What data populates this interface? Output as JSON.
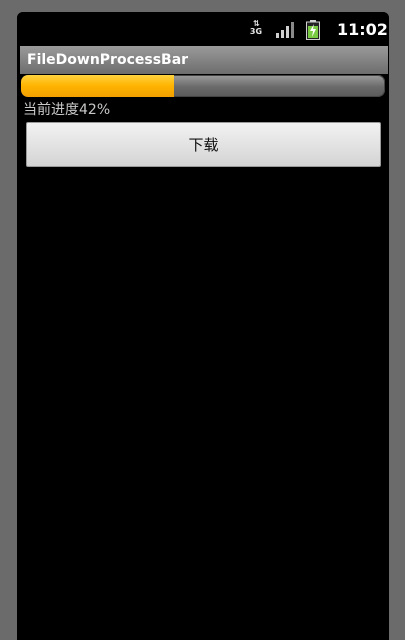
{
  "status_bar": {
    "network": "3G",
    "signal_icon": "signal-icon",
    "battery_icon": "battery-charging-icon",
    "time": "11:02"
  },
  "app": {
    "title": "FileDownProcessBar"
  },
  "progress": {
    "value": 0.42,
    "label": "当前进度42%",
    "fill_color": "#ffb300"
  },
  "actions": {
    "download_label": "下载"
  }
}
